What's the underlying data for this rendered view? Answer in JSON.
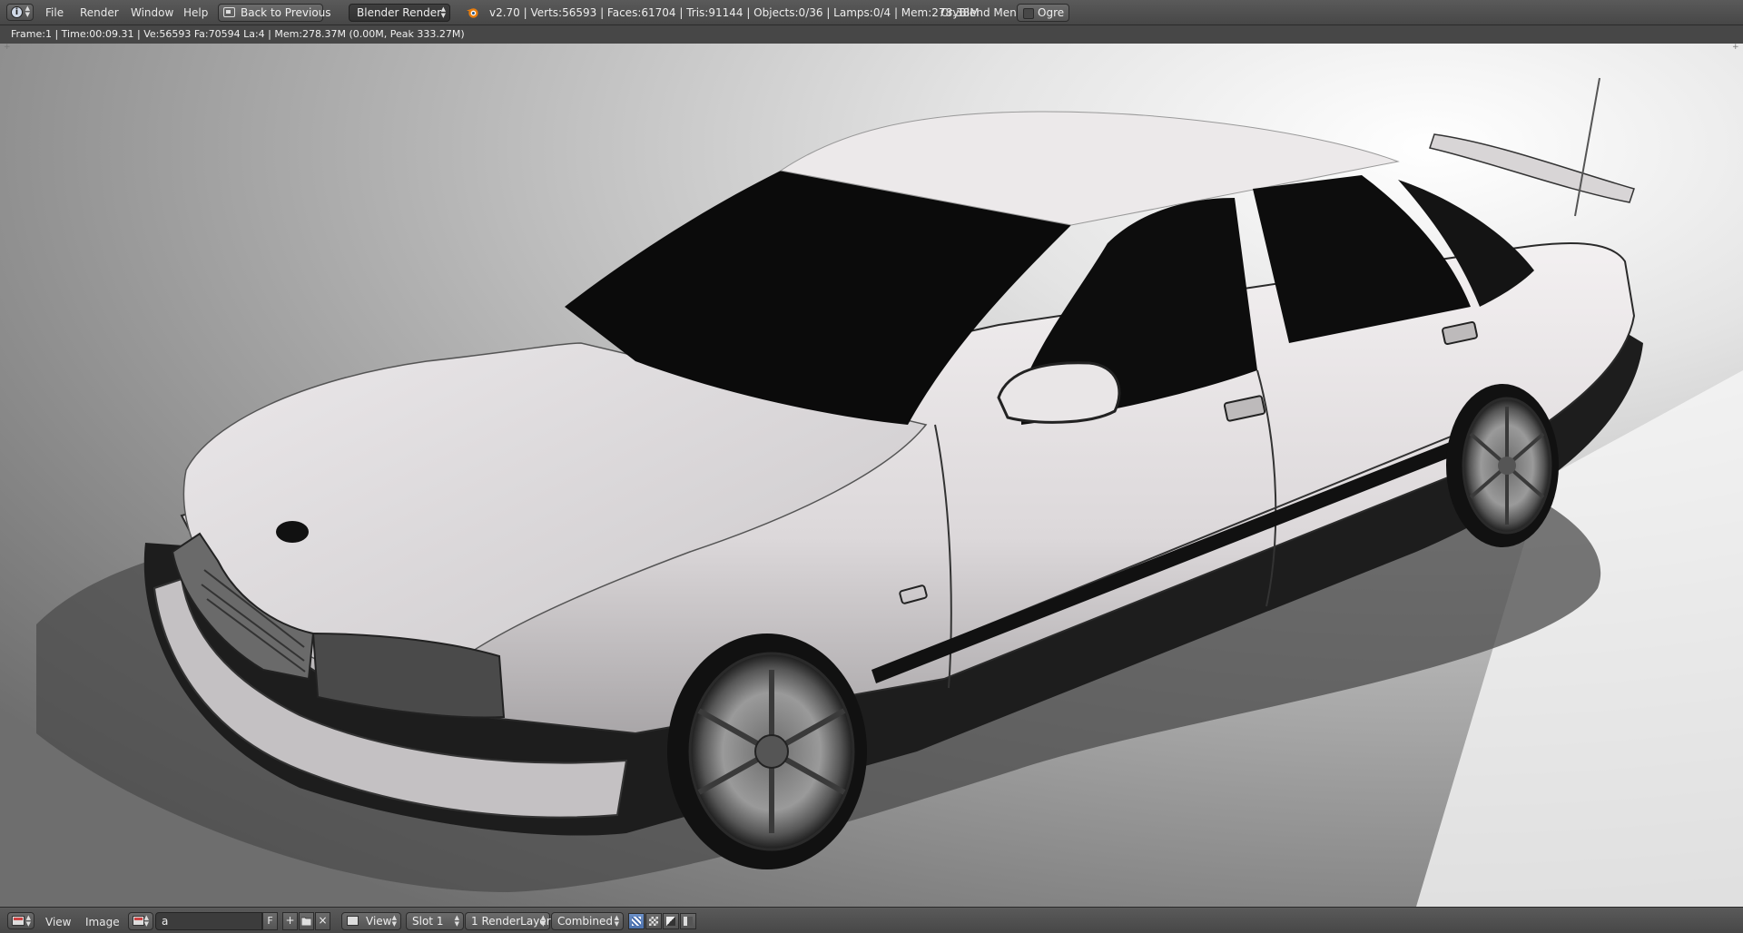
{
  "top_header": {
    "menus": [
      "File",
      "Render",
      "Window",
      "Help"
    ],
    "back_button": "Back to Previous",
    "render_engine": "Blender Render",
    "stats": "v2.70 | Verts:56593 | Faces:61704 | Tris:91144 | Objects:0/36 | Lamps:0/4 | Mem:278.38M",
    "cryblend_menu": "CryBlend Menu",
    "ogre": "Ogre",
    "icons": {
      "editor_type": "info-icon",
      "back": "back-to-previous-icon",
      "logo": "blender-logo-icon"
    }
  },
  "render_info": "Frame:1 | Time:00:09.31 | Ve:56593 Fa:70594 La:4 | Mem:278.37M (0.00M, Peak 333.27M)",
  "viewport": {
    "content": "rendered-car-image"
  },
  "bottom_header": {
    "menus": [
      "View",
      "Image"
    ],
    "image_name": "a",
    "fake_user": "F",
    "add_button": "+",
    "open_icon": "folder-icon",
    "close_button": "×",
    "view_select": "View",
    "slot_select": "Slot 1",
    "render_layer_select": "1 RenderLayer",
    "pass_select": "Combined",
    "icons": {
      "editor_type": "image-editor-icon",
      "image_browse": "image-browse-icon",
      "tools": [
        "draw-icon",
        "alpha-icon",
        "z-buffer-icon",
        "channels-icon"
      ]
    }
  },
  "colors": {
    "header_bg": "#4b4b4b",
    "active_blue": "#5680c2"
  }
}
